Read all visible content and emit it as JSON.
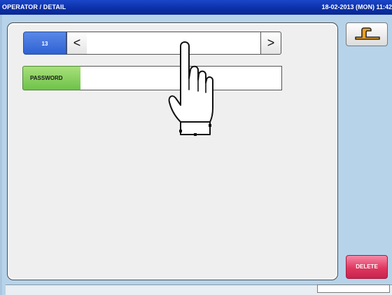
{
  "header": {
    "title": "OPERATOR / DETAIL",
    "datetime": "18-02-2013 (MON) 11:42"
  },
  "operator": {
    "number": "13",
    "prev_icon": "chevron-left-icon",
    "prev_glyph": "<",
    "next_icon": "chevron-right-icon",
    "next_glyph": ">",
    "name_value": ""
  },
  "password": {
    "label": "PASSWORD",
    "value": ""
  },
  "buttons": {
    "back_icon": "return-arrow-icon",
    "delete_label": "DELETE"
  },
  "status": {
    "text": ""
  },
  "gesture": {
    "icon": "tap-hand-icon"
  },
  "colors": {
    "title_bar": "#0b2fa6",
    "background": "#b6d3ea",
    "number_badge": "#2f62d3",
    "password_label": "#6ec24a",
    "delete_button": "#e0375f"
  }
}
